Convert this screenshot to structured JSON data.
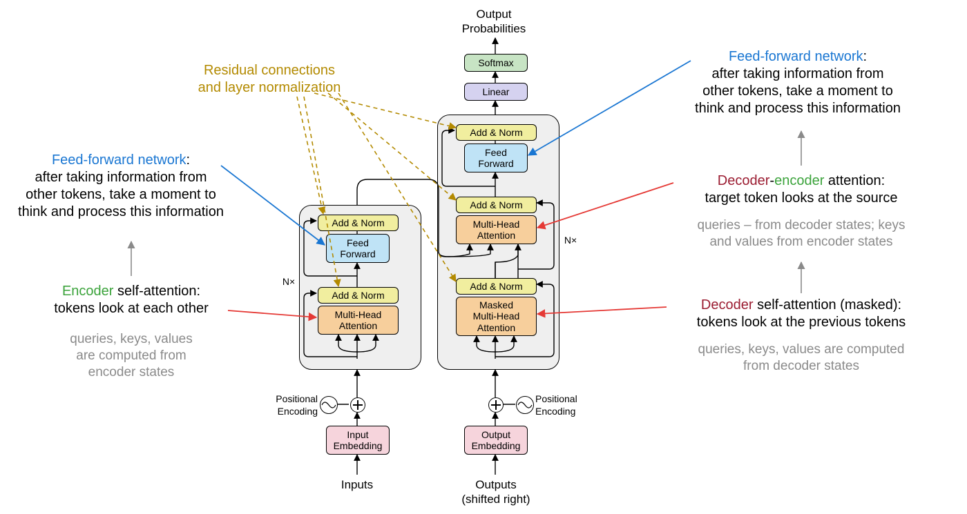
{
  "top": {
    "out_prob_l1": "Output",
    "out_prob_l2": "Probabilities",
    "softmax": "Softmax",
    "linear": "Linear"
  },
  "enc": {
    "addnorm2": "Add & Norm",
    "ff_l1": "Feed",
    "ff_l2": "Forward",
    "addnorm1": "Add & Norm",
    "mha_l1": "Multi-Head",
    "mha_l2": "Attention",
    "embed_l1": "Input",
    "embed_l2": "Embedding",
    "inputs": "Inputs",
    "pe_l1": "Positional",
    "pe_l2": "Encoding",
    "nx": "N×"
  },
  "dec": {
    "addnorm3": "Add & Norm",
    "ff_l1": "Feed",
    "ff_l2": "Forward",
    "addnorm2": "Add & Norm",
    "mha_l1": "Multi-Head",
    "mha_l2": "Attention",
    "addnorm1": "Add & Norm",
    "mmha_l1": "Masked",
    "mmha_l2": "Multi-Head",
    "mmha_l3": "Attention",
    "embed_l1": "Output",
    "embed_l2": "Embedding",
    "out_l1": "Outputs",
    "out_l2": "(shifted right)",
    "pe_l1": "Positional",
    "pe_l2": "Encoding",
    "nx": "N×"
  },
  "ann": {
    "resid_l1": "Residual connections",
    "resid_l2": "and layer normalization",
    "ffn_title": "Feed-forward network",
    "ffn_l1": "after taking information from",
    "ffn_l2": "other tokens, take a moment to",
    "ffn_l3": "think and process this information",
    "enc_sa_title_a": "Encoder",
    "enc_sa_title_b": " self-attention:",
    "enc_sa_l1": "tokens look at each other",
    "enc_sa_g1": "queries, keys, values",
    "enc_sa_g2": "are computed from",
    "enc_sa_g3": "encoder states",
    "dec_sa_title_a": "Decoder",
    "dec_sa_title_b": " self-attention (masked):",
    "dec_sa_l1": "tokens look at the previous tokens",
    "dec_sa_g1": "queries, keys, values are computed",
    "dec_sa_g2": "from decoder states",
    "de_att_a": "Decoder",
    "de_att_dash": "-",
    "de_att_b": "encoder",
    "de_att_c": " attention:",
    "de_att_l1": "target token looks at the source",
    "de_att_g1": "queries – from decoder states; keys",
    "de_att_g2": "and values from encoder states"
  }
}
